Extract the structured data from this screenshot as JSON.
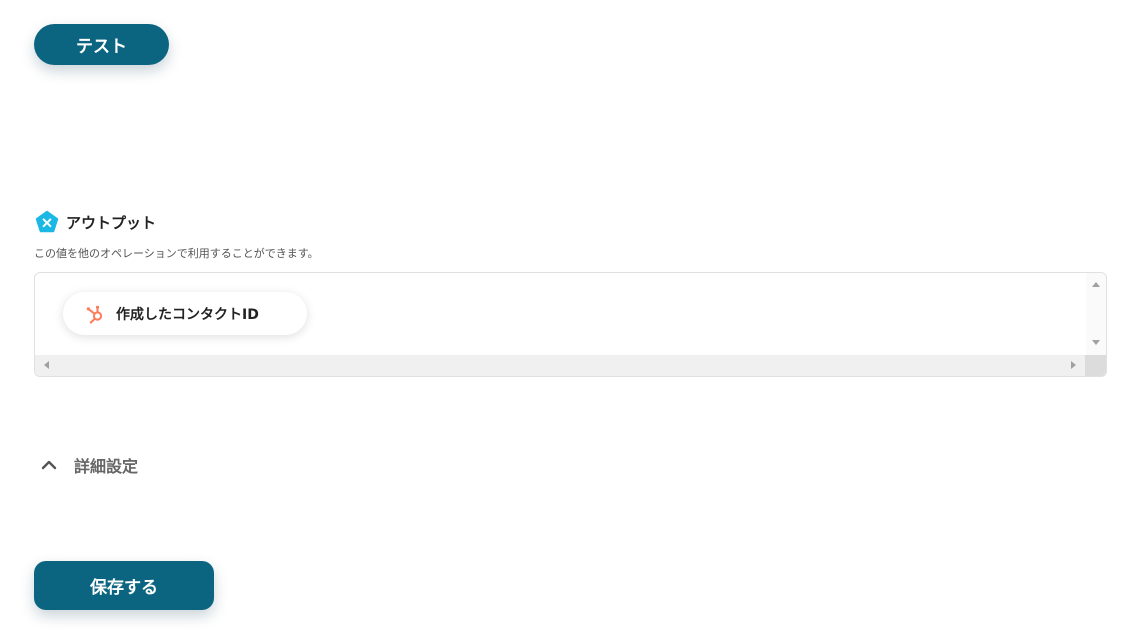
{
  "buttons": {
    "test_label": "テスト",
    "save_label": "保存する"
  },
  "output": {
    "title": "アウトプット",
    "description": "この値を他のオペレーションで利用することができます。",
    "items": [
      {
        "label": "作成したコンタクトID",
        "icon": "hubspot-icon"
      }
    ]
  },
  "advanced": {
    "label": "詳細設定",
    "icon": "chevron-up-icon"
  },
  "colors": {
    "primary": "#0c6580",
    "yoom_icon": "#1bb8e6",
    "hubspot": "#ff7a59"
  }
}
